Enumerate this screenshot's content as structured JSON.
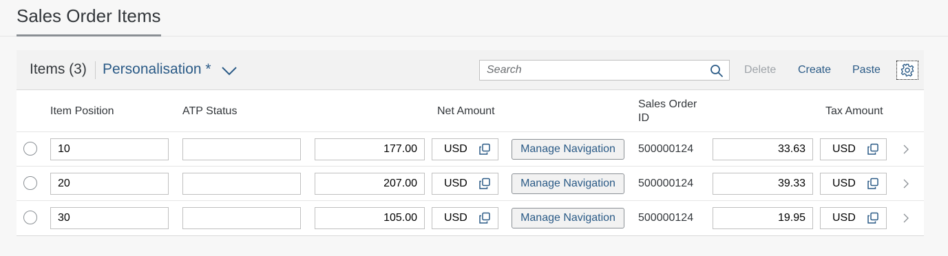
{
  "section": {
    "title": "Sales Order Items"
  },
  "toolbar": {
    "title": "Items (3)",
    "variant": "Personalisation *",
    "search_placeholder": "Search",
    "delete_label": "Delete",
    "create_label": "Create",
    "paste_label": "Paste"
  },
  "columns": {
    "item_position": "Item Position",
    "atp_status": "ATP Status",
    "net_amount": "Net Amount",
    "sales_order_id_line1": "Sales Order",
    "sales_order_id_line2": "ID",
    "tax_amount": "Tax Amount"
  },
  "rows": [
    {
      "item_position": "10",
      "atp_status": "",
      "net_amount": "177.00",
      "net_currency": "USD",
      "manage_label": "Manage Navigation",
      "sales_order_id": "500000124",
      "tax_amount": "33.63",
      "tax_currency": "USD"
    },
    {
      "item_position": "20",
      "atp_status": "",
      "net_amount": "207.00",
      "net_currency": "USD",
      "manage_label": "Manage Navigation",
      "sales_order_id": "500000124",
      "tax_amount": "39.33",
      "tax_currency": "USD"
    },
    {
      "item_position": "30",
      "atp_status": "",
      "net_amount": "105.00",
      "net_currency": "USD",
      "manage_label": "Manage Navigation",
      "sales_order_id": "500000124",
      "tax_amount": "19.95",
      "tax_currency": "USD"
    }
  ],
  "icons": {
    "variant_dropdown": "chevron-down-icon",
    "search": "search-icon",
    "settings": "gear-icon",
    "copy": "copy-icon",
    "navigate": "chevron-right-icon"
  },
  "colors": {
    "accent": "#2a5a86",
    "disabled": "#9ea3a8",
    "text": "#32363a"
  }
}
